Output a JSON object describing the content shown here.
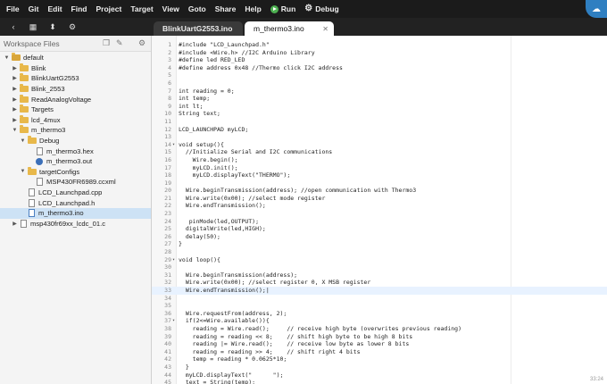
{
  "menubar": {
    "items": [
      "File",
      "Git",
      "Edit",
      "Find",
      "Project",
      "Target",
      "View",
      "Goto",
      "Share",
      "Help"
    ],
    "run_label": "Run",
    "debug_label": "Debug"
  },
  "tabs": [
    {
      "label": "BlinkUartG2553.ino"
    },
    {
      "label": "m_thermo3.ino"
    }
  ],
  "sidebar": {
    "title": "Workspace Files",
    "tree": [
      {
        "label": "default",
        "type": "folder-root",
        "indent": 0,
        "expanded": true
      },
      {
        "label": "Blink",
        "type": "folder",
        "indent": 1,
        "expanded": false
      },
      {
        "label": "BlinkUartG2553",
        "type": "folder",
        "indent": 1,
        "expanded": false
      },
      {
        "label": "Blink_2553",
        "type": "folder",
        "indent": 1,
        "expanded": false
      },
      {
        "label": "ReadAnalogVoltage",
        "type": "folder",
        "indent": 1,
        "expanded": false
      },
      {
        "label": "Targets",
        "type": "folder",
        "indent": 1,
        "expanded": false
      },
      {
        "label": "lcd_4mux",
        "type": "folder",
        "indent": 1,
        "expanded": false
      },
      {
        "label": "m_thermo3",
        "type": "folder",
        "indent": 1,
        "expanded": true
      },
      {
        "label": "Debug",
        "type": "folder",
        "indent": 2,
        "expanded": true
      },
      {
        "label": "m_thermo3.hex",
        "type": "file",
        "indent": 3
      },
      {
        "label": "m_thermo3.out",
        "type": "out",
        "indent": 3
      },
      {
        "label": "targetConfigs",
        "type": "folder",
        "indent": 2,
        "expanded": true
      },
      {
        "label": "MSP430FR6989.ccxml",
        "type": "file",
        "indent": 3
      },
      {
        "label": "LCD_Launchpad.cpp",
        "type": "file",
        "indent": 2
      },
      {
        "label": "LCD_Launchpad.h",
        "type": "file",
        "indent": 2
      },
      {
        "label": "m_thermo3.ino",
        "type": "file-blue",
        "indent": 2,
        "selected": true
      },
      {
        "label": "msp430fr69xx_lcdc_01.c",
        "type": "file",
        "indent": 1,
        "expanded": false
      }
    ]
  },
  "editor": {
    "active_line": 33,
    "corner_text": "33:24",
    "lines": [
      {
        "n": "1",
        "fold": "",
        "text": "#include \"LCD_Launchpad.h\""
      },
      {
        "n": "2",
        "fold": "",
        "text": "#include <Wire.h> //I2C Arduino Library"
      },
      {
        "n": "3",
        "fold": "",
        "text": "#define led RED_LED"
      },
      {
        "n": "4",
        "fold": "",
        "text": "#define address 0x48 //Thermo click I2C address"
      },
      {
        "n": "5",
        "fold": "",
        "text": ""
      },
      {
        "n": "6",
        "fold": "",
        "text": ""
      },
      {
        "n": "7",
        "fold": "",
        "text": "int reading = 0;"
      },
      {
        "n": "8",
        "fold": "",
        "text": "int temp;"
      },
      {
        "n": "9",
        "fold": "",
        "text": "int lt;"
      },
      {
        "n": "10",
        "fold": "",
        "text": "String text;"
      },
      {
        "n": "11",
        "fold": "",
        "text": ""
      },
      {
        "n": "12",
        "fold": "",
        "text": "LCD_LAUNCHPAD myLCD;"
      },
      {
        "n": "13",
        "fold": "",
        "text": ""
      },
      {
        "n": "14",
        "fold": "▾",
        "text": "void setup(){"
      },
      {
        "n": "15",
        "fold": "",
        "text": "  //Initialize Serial and I2C communications"
      },
      {
        "n": "16",
        "fold": "",
        "text": "    Wire.begin();"
      },
      {
        "n": "17",
        "fold": "",
        "text": "    myLCD.init();"
      },
      {
        "n": "18",
        "fold": "",
        "text": "    myLCD.displayText(\"THERMO\");"
      },
      {
        "n": "19",
        "fold": "",
        "text": ""
      },
      {
        "n": "20",
        "fold": "",
        "text": "  Wire.beginTransmission(address); //open communication with Thermo3"
      },
      {
        "n": "21",
        "fold": "",
        "text": "  Wire.write(0x00); //select mode register"
      },
      {
        "n": "22",
        "fold": "",
        "text": "  Wire.endTransmission();"
      },
      {
        "n": "23",
        "fold": "",
        "text": ""
      },
      {
        "n": "24",
        "fold": "",
        "text": "   pinMode(led,OUTPUT);"
      },
      {
        "n": "25",
        "fold": "",
        "text": "  digitalWrite(led,HIGH);"
      },
      {
        "n": "26",
        "fold": "",
        "text": "  delay(50);"
      },
      {
        "n": "27",
        "fold": "",
        "text": "}"
      },
      {
        "n": "28",
        "fold": "",
        "text": ""
      },
      {
        "n": "29",
        "fold": "▾",
        "text": "void loop(){"
      },
      {
        "n": "30",
        "fold": "",
        "text": ""
      },
      {
        "n": "31",
        "fold": "",
        "text": "  Wire.beginTransmission(address);"
      },
      {
        "n": "32",
        "fold": "",
        "text": "  Wire.write(0x00); //select register 0, X MSB register"
      },
      {
        "n": "33",
        "fold": "",
        "text": "  Wire.endTransmission();|"
      },
      {
        "n": "34",
        "fold": "",
        "text": ""
      },
      {
        "n": "35",
        "fold": "",
        "text": ""
      },
      {
        "n": "36",
        "fold": "",
        "text": "  Wire.requestFrom(address, 2);"
      },
      {
        "n": "37",
        "fold": "▾",
        "text": "  if(2<=Wire.available()){"
      },
      {
        "n": "38",
        "fold": "",
        "text": "    reading = Wire.read();     // receive high byte (overwrites previous reading)"
      },
      {
        "n": "39",
        "fold": "",
        "text": "    reading = reading << 8;    // shift high byte to be high 8 bits"
      },
      {
        "n": "40",
        "fold": "",
        "text": "    reading |= Wire.read();    // receive low byte as lower 8 bits"
      },
      {
        "n": "41",
        "fold": "",
        "text": "    reading = reading >> 4;    // shift right 4 bits"
      },
      {
        "n": "42",
        "fold": "",
        "text": "    temp = reading * 0.0625*10;"
      },
      {
        "n": "43",
        "fold": "",
        "text": "  }"
      },
      {
        "n": "44",
        "fold": "",
        "text": "  myLCD.displayText(\"      \");"
      },
      {
        "n": "45",
        "fold": "",
        "text": "  text = String(temp);"
      },
      {
        "n": "46",
        "fold": "",
        "text": "  text.trim();"
      },
      {
        "n": "47",
        "fold": "",
        "text": "  lt = text.length();"
      }
    ]
  }
}
